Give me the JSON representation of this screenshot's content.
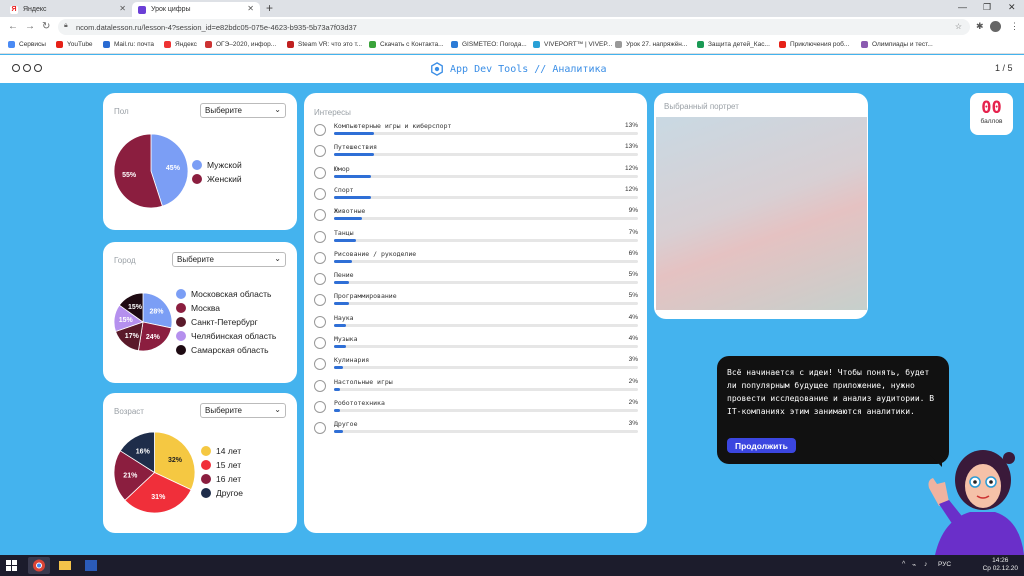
{
  "browser": {
    "tabs": [
      {
        "label": "Яндекс",
        "active": false
      },
      {
        "label": "Урок цифры",
        "active": true
      }
    ],
    "url": "ncom.datalesson.ru/lesson-4?session_id=e82bdc05-075e-4623-b935-5b73a7f03d37",
    "bookmarks": [
      "Сервисы",
      "YouTube",
      "Mail.ru: почта",
      "Яндекс",
      "ОГЭ–2020, инфор...",
      "Steam VR: что это т...",
      "Скачать с Контакта...",
      "GISMETEO: Погода...",
      "VIVEPORT™ | VIVEP...",
      "Урок 27. напряжён...",
      "Защита детей_Кас...",
      "Приключения роб...",
      "Олимпиады и тест..."
    ]
  },
  "app": {
    "title": "App Dev Tools // Аналитика",
    "pager": "1 / 5"
  },
  "gender": {
    "label": "Пол",
    "select": "Выберите",
    "items": [
      {
        "label": "Мужской",
        "value": 45,
        "pct": "45%",
        "color": "#7b9ef5"
      },
      {
        "label": "Женский",
        "value": 55,
        "pct": "55%",
        "color": "#8b1e3f"
      }
    ]
  },
  "city": {
    "label": "Город",
    "select": "Выберите",
    "items": [
      {
        "label": "Московская область",
        "value": 28,
        "pct": "28%",
        "color": "#7b9ef5"
      },
      {
        "label": "Москва",
        "value": 24,
        "pct": "24%",
        "color": "#8b1e3f"
      },
      {
        "label": "Санкт-Петербург",
        "value": 17,
        "pct": "17%",
        "color": "#5a1a2a"
      },
      {
        "label": "Челябинская область",
        "value": 15,
        "pct": "15%",
        "color": "#b590ee"
      },
      {
        "label": "Самарская область",
        "value": 15,
        "pct": "15%",
        "color": "#1e0a12"
      }
    ]
  },
  "age": {
    "label": "Возраст",
    "select": "Выберите",
    "items": [
      {
        "label": "14 лет",
        "value": 32,
        "pct": "32%",
        "color": "#f5c842"
      },
      {
        "label": "15 лет",
        "value": 31,
        "pct": "31%",
        "color": "#f02f3a"
      },
      {
        "label": "16 лет",
        "value": 21,
        "pct": "21%",
        "color": "#8b1e3f"
      },
      {
        "label": "Другое",
        "value": 16,
        "pct": "16%",
        "color": "#1e2d4a"
      }
    ]
  },
  "interests": {
    "label": "Интересы",
    "items": [
      {
        "label": "Компьютерные игры и киберспорт",
        "pct": "13%",
        "value": 13
      },
      {
        "label": "Путешествия",
        "pct": "13%",
        "value": 13
      },
      {
        "label": "Юмор",
        "pct": "12%",
        "value": 12
      },
      {
        "label": "Спорт",
        "pct": "12%",
        "value": 12
      },
      {
        "label": "Животные",
        "pct": "9%",
        "value": 9
      },
      {
        "label": "Танцы",
        "pct": "7%",
        "value": 7
      },
      {
        "label": "Рисование / рукоделие",
        "pct": "6%",
        "value": 6
      },
      {
        "label": "Пение",
        "pct": "5%",
        "value": 5
      },
      {
        "label": "Программирование",
        "pct": "5%",
        "value": 5
      },
      {
        "label": "Наука",
        "pct": "4%",
        "value": 4
      },
      {
        "label": "Музыка",
        "pct": "4%",
        "value": 4
      },
      {
        "label": "Кулинария",
        "pct": "3%",
        "value": 3
      },
      {
        "label": "Настольные игры",
        "pct": "2%",
        "value": 2
      },
      {
        "label": "Робототехника",
        "pct": "2%",
        "value": 2
      },
      {
        "label": "Другое",
        "pct": "3%",
        "value": 3
      }
    ]
  },
  "portrait": {
    "label": "Выбранный портрет"
  },
  "score": {
    "value": "00",
    "label": "баллов"
  },
  "bubble": {
    "text": "Всё начинается с идеи! Чтобы понять, будет ли популярным будущее приложение, нужно провести исследование и анализ аудитории. В IT-компаниях этим занимаются аналитики.",
    "button": "Продолжить"
  },
  "taskbar": {
    "lang": "РУС",
    "time": "14:26",
    "date": "Ср 02.12.20"
  }
}
